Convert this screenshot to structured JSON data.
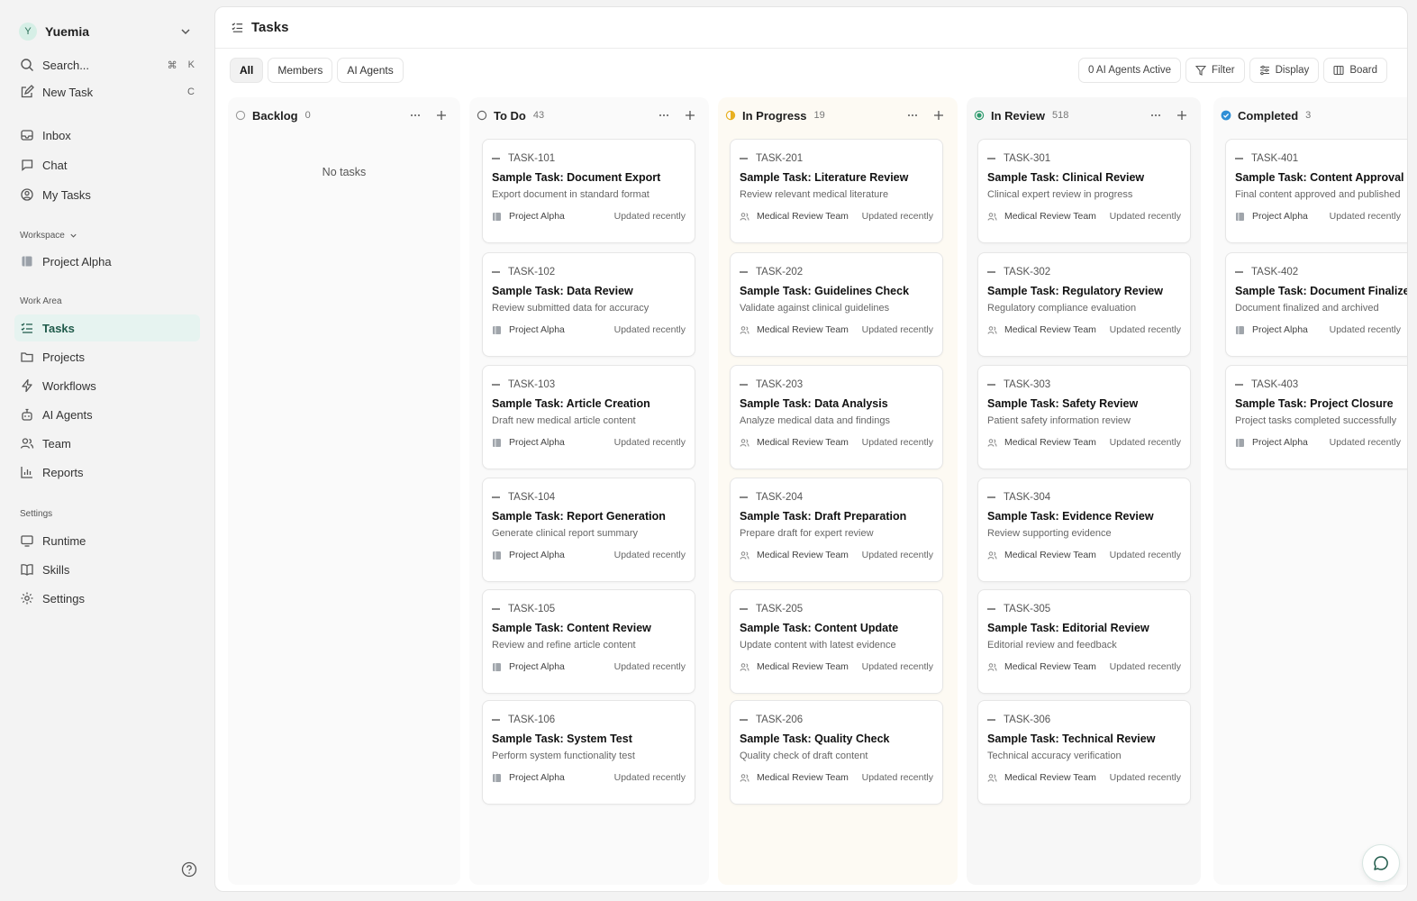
{
  "sidebar": {
    "workspace_avatar": "Y",
    "workspace_name": "Yuemia",
    "search_label": "Search...",
    "search_kbd_1": "⌘",
    "search_kbd_2": "K",
    "new_task_label": "New Task",
    "new_task_kbd": "C",
    "nav": {
      "inbox": "Inbox",
      "chat": "Chat",
      "my_tasks": "My Tasks"
    },
    "workspace_section": "Workspace",
    "project": "Project Alpha",
    "work_area_section": "Work Area",
    "work_area": {
      "tasks": "Tasks",
      "projects": "Projects",
      "workflows": "Workflows",
      "ai_agents": "AI Agents",
      "team": "Team",
      "reports": "Reports"
    },
    "settings_section": "Settings",
    "settings": {
      "runtime": "Runtime",
      "skills": "Skills",
      "settings": "Settings"
    }
  },
  "header": {
    "title": "Tasks"
  },
  "toolbar": {
    "tabs": [
      "All",
      "Members",
      "AI Agents"
    ],
    "active_tab": "All",
    "agents_active": "0 AI Agents Active",
    "filter": "Filter",
    "display": "Display",
    "board": "Board"
  },
  "status_colors": {
    "in_progress": "#e8b020",
    "in_review": "#2f9b6e",
    "completed": "#2f8fd6",
    "accent": "#1f5a4a"
  },
  "columns": [
    {
      "title": "Backlog",
      "count": "0",
      "empty": "No tasks",
      "cards": []
    },
    {
      "title": "To Do",
      "count": "43",
      "cards": [
        {
          "id": "TASK-101",
          "title": "Sample Task: Document Export",
          "desc": "Export document in standard format",
          "project": "Project Alpha",
          "updated": "Updated recently"
        },
        {
          "id": "TASK-102",
          "title": "Sample Task: Data Review",
          "desc": "Review submitted data for accuracy",
          "project": "Project Alpha",
          "updated": "Updated recently"
        },
        {
          "id": "TASK-103",
          "title": "Sample Task: Article Creation",
          "desc": "Draft new medical article content",
          "project": "Project Alpha",
          "updated": "Updated recently"
        },
        {
          "id": "TASK-104",
          "title": "Sample Task: Report Generation",
          "desc": "Generate clinical report summary",
          "project": "Project Alpha",
          "updated": "Updated recently"
        },
        {
          "id": "TASK-105",
          "title": "Sample Task: Content Review",
          "desc": "Review and refine article content",
          "project": "Project Alpha",
          "updated": "Updated recently"
        },
        {
          "id": "TASK-106",
          "title": "Sample Task: System Test",
          "desc": "Perform system functionality test",
          "project": "Project Alpha",
          "updated": "Updated recently"
        }
      ]
    },
    {
      "title": "In Progress",
      "count": "19",
      "cards": [
        {
          "id": "TASK-201",
          "title": "Sample Task: Literature Review",
          "desc": "Review relevant medical literature",
          "project": "Medical Review Team",
          "updated": "Updated recently"
        },
        {
          "id": "TASK-202",
          "title": "Sample Task: Guidelines Check",
          "desc": "Validate against clinical guidelines",
          "project": "Medical Review Team",
          "updated": "Updated recently"
        },
        {
          "id": "TASK-203",
          "title": "Sample Task: Data Analysis",
          "desc": "Analyze medical data and findings",
          "project": "Medical Review Team",
          "updated": "Updated recently"
        },
        {
          "id": "TASK-204",
          "title": "Sample Task: Draft Preparation",
          "desc": "Prepare draft for expert review",
          "project": "Medical Review Team",
          "updated": "Updated recently"
        },
        {
          "id": "TASK-205",
          "title": "Sample Task: Content Update",
          "desc": "Update content with latest evidence",
          "project": "Medical Review Team",
          "updated": "Updated recently"
        },
        {
          "id": "TASK-206",
          "title": "Sample Task: Quality Check",
          "desc": "Quality check of draft content",
          "project": "Medical Review Team",
          "updated": "Updated recently"
        }
      ]
    },
    {
      "title": "In Review",
      "count": "518",
      "cards": [
        {
          "id": "TASK-301",
          "title": "Sample Task: Clinical Review",
          "desc": "Clinical expert review in progress",
          "project": "Medical Review Team",
          "updated": "Updated recently"
        },
        {
          "id": "TASK-302",
          "title": "Sample Task: Regulatory Review",
          "desc": "Regulatory compliance evaluation",
          "project": "Medical Review Team",
          "updated": "Updated recently"
        },
        {
          "id": "TASK-303",
          "title": "Sample Task: Safety Review",
          "desc": "Patient safety information review",
          "project": "Medical Review Team",
          "updated": "Updated recently"
        },
        {
          "id": "TASK-304",
          "title": "Sample Task: Evidence Review",
          "desc": "Review supporting evidence",
          "project": "Medical Review Team",
          "updated": "Updated recently"
        },
        {
          "id": "TASK-305",
          "title": "Sample Task: Editorial Review",
          "desc": "Editorial review and feedback",
          "project": "Medical Review Team",
          "updated": "Updated recently"
        },
        {
          "id": "TASK-306",
          "title": "Sample Task: Technical Review",
          "desc": "Technical accuracy verification",
          "project": "Medical Review Team",
          "updated": "Updated recently"
        }
      ]
    },
    {
      "title": "Completed",
      "count": "3",
      "cards": [
        {
          "id": "TASK-401",
          "title": "Sample Task: Content Approval",
          "desc": "Final content approved and published",
          "project": "Project Alpha",
          "updated": "Updated recently"
        },
        {
          "id": "TASK-402",
          "title": "Sample Task: Document Finalized",
          "desc": "Document finalized and archived",
          "project": "Project Alpha",
          "updated": "Updated recently"
        },
        {
          "id": "TASK-403",
          "title": "Sample Task: Project Closure",
          "desc": "Project tasks completed successfully",
          "project": "Project Alpha",
          "updated": "Updated recently"
        }
      ]
    }
  ]
}
